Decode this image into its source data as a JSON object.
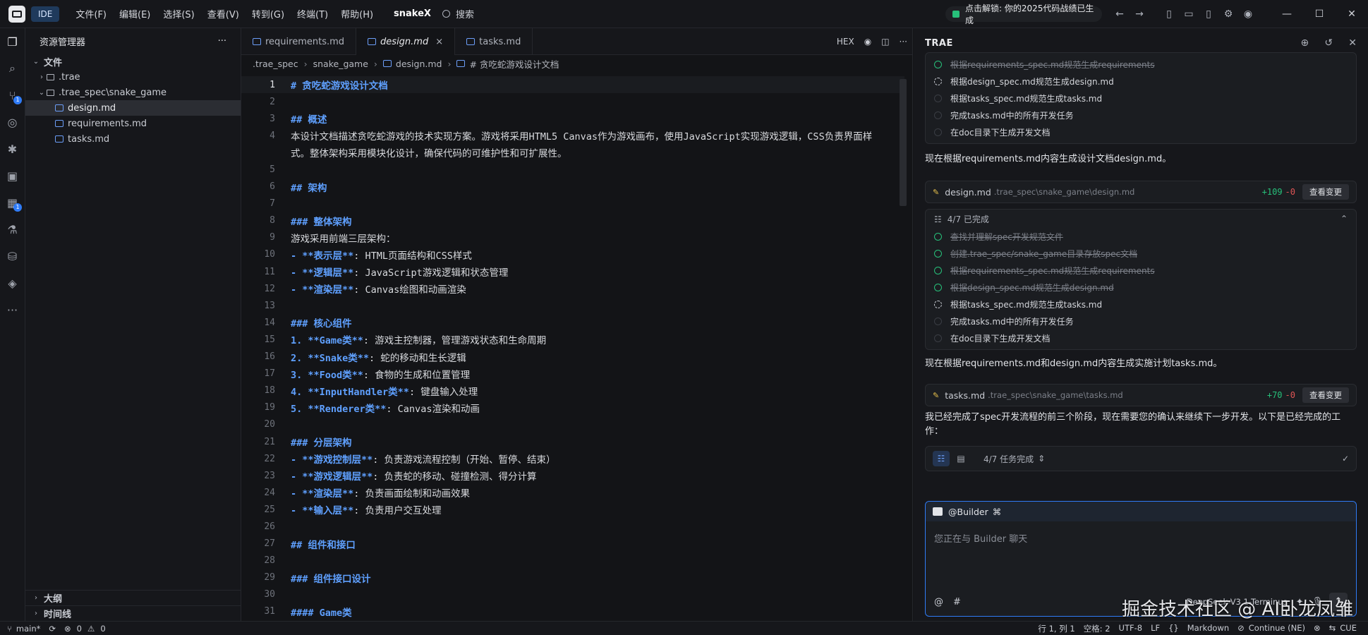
{
  "titlebar": {
    "ide_label": "IDE",
    "menu": [
      "文件(F)",
      "编辑(E)",
      "选择(S)",
      "查看(V)",
      "转到(G)",
      "终端(T)",
      "帮助(H)"
    ],
    "project": "snakeX",
    "search_label": "搜索",
    "promo": "点击解锁: 你的2025代码战绩已生成"
  },
  "explorer": {
    "title": "资源管理器",
    "more": "···",
    "root": "文件",
    "items": [
      {
        "label": ".trae",
        "type": "folder"
      },
      {
        "label": ".trae_spec\\snake_game",
        "type": "folder-open"
      },
      {
        "label": "design.md",
        "type": "file"
      },
      {
        "label": "requirements.md",
        "type": "file"
      },
      {
        "label": "tasks.md",
        "type": "file"
      }
    ],
    "outline": "大纲",
    "timeline": "时间线"
  },
  "editor": {
    "tabs": [
      {
        "label": "requirements.md"
      },
      {
        "label": "design.md",
        "close": "×"
      },
      {
        "label": "tasks.md"
      }
    ],
    "tools": {
      "hex": "HEX"
    },
    "breadcrumb": [
      ".trae_spec",
      "snake_game",
      "design.md",
      "# 贪吃蛇游戏设计文档"
    ],
    "lines": [
      {
        "n": "1",
        "t": "# 贪吃蛇游戏设计文档",
        "k": "h"
      },
      {
        "n": "2",
        "t": "",
        "k": ""
      },
      {
        "n": "3",
        "t": "## 概述",
        "k": "h"
      },
      {
        "n": "4",
        "t": "本设计文档描述贪吃蛇游戏的技术实现方案。游戏将采用HTML5 Canvas作为游戏画布，使用JavaScript实现游戏逻辑，CSS负责界面样",
        "k": ""
      },
      {
        "n": "",
        "t": "式。整体架构采用模块化设计，确保代码的可维护性和可扩展性。",
        "k": ""
      },
      {
        "n": "5",
        "t": "",
        "k": ""
      },
      {
        "n": "6",
        "t": "## 架构",
        "k": "h"
      },
      {
        "n": "7",
        "t": "",
        "k": ""
      },
      {
        "n": "8",
        "t": "### 整体架构",
        "k": "h"
      },
      {
        "n": "9",
        "t": "游戏采用前端三层架构：",
        "k": ""
      },
      {
        "n": "10",
        "m": "- **表示层**",
        "t": ": HTML页面结构和CSS样式",
        "k": "l"
      },
      {
        "n": "11",
        "m": "- **逻辑层**",
        "t": ": JavaScript游戏逻辑和状态管理",
        "k": "l"
      },
      {
        "n": "12",
        "m": "- **渲染层**",
        "t": ": Canvas绘图和动画渲染",
        "k": "l"
      },
      {
        "n": "13",
        "t": "",
        "k": ""
      },
      {
        "n": "14",
        "t": "### 核心组件",
        "k": "h"
      },
      {
        "n": "15",
        "m": "1. **Game类**",
        "t": ": 游戏主控制器，管理游戏状态和生命周期",
        "k": "l"
      },
      {
        "n": "16",
        "m": "2. **Snake类**",
        "t": ": 蛇的移动和生长逻辑",
        "k": "l"
      },
      {
        "n": "17",
        "m": "3. **Food类**",
        "t": ": 食物的生成和位置管理",
        "k": "l"
      },
      {
        "n": "18",
        "m": "4. **InputHandler类**",
        "t": ": 键盘输入处理",
        "k": "l"
      },
      {
        "n": "19",
        "m": "5. **Renderer类**",
        "t": ": Canvas渲染和动画",
        "k": "l"
      },
      {
        "n": "20",
        "t": "",
        "k": ""
      },
      {
        "n": "21",
        "t": "### 分层架构",
        "k": "h"
      },
      {
        "n": "22",
        "m": "- **游戏控制层**",
        "t": ": 负责游戏流程控制（开始、暂停、结束）",
        "k": "l"
      },
      {
        "n": "23",
        "m": "- **游戏逻辑层**",
        "t": ": 负责蛇的移动、碰撞检测、得分计算",
        "k": "l"
      },
      {
        "n": "24",
        "m": "- **渲染层**",
        "t": ": 负责画面绘制和动画效果",
        "k": "l"
      },
      {
        "n": "25",
        "m": "- **输入层**",
        "t": ": 负责用户交互处理",
        "k": "l"
      },
      {
        "n": "26",
        "t": "",
        "k": ""
      },
      {
        "n": "27",
        "t": "## 组件和接口",
        "k": "h"
      },
      {
        "n": "28",
        "t": "",
        "k": ""
      },
      {
        "n": "29",
        "t": "### 组件接口设计",
        "k": "h"
      },
      {
        "n": "30",
        "t": "",
        "k": ""
      },
      {
        "n": "31",
        "t": "#### Game类",
        "k": "h"
      }
    ]
  },
  "chat": {
    "title": "TRAE",
    "todo_top": [
      {
        "label": "根据requirements_spec.md规范生成requirements",
        "state": "done"
      },
      {
        "label": "根据design_spec.md规范生成design.md",
        "state": "spin"
      },
      {
        "label": "根据tasks_spec.md规范生成tasks.md",
        "state": "open"
      },
      {
        "label": "完成tasks.md中的所有开发任务",
        "state": "open"
      },
      {
        "label": "在doc目录下生成开发文档",
        "state": "open"
      }
    ],
    "msg1": "现在根据requirements.md内容生成设计文档design.md。",
    "file1": {
      "name": "design.md",
      "path": ".trae_spec\\snake_game\\design.md",
      "add": "+109",
      "del": "-0",
      "btn": "查看变更"
    },
    "progress_label": "4/7 已完成",
    "todo_mid": [
      {
        "label": "查找并理解spec开发规范文件",
        "state": "done"
      },
      {
        "label": "创建.trae_spec/snake_game目录存放spec文档",
        "state": "done"
      },
      {
        "label": "根据requirements_spec.md规范生成requirements",
        "state": "done"
      },
      {
        "label": "根据design_spec.md规范生成design.md",
        "state": "done"
      },
      {
        "label": "根据tasks_spec.md规范生成tasks.md",
        "state": "spin"
      },
      {
        "label": "完成tasks.md中的所有开发任务",
        "state": "open"
      },
      {
        "label": "在doc目录下生成开发文档",
        "state": "open"
      }
    ],
    "msg2": "现在根据requirements.md和design.md内容生成实施计划tasks.md。",
    "file2": {
      "name": "tasks.md",
      "path": ".trae_spec\\snake_game\\tasks.md",
      "add": "+70",
      "del": "-0",
      "btn": "查看变更"
    },
    "msg3": "我已经完成了spec开发流程的前三个阶段，现在需要您的确认来继续下一步开发。以下是已经完成的工作：",
    "task_bar": "4/7 任务完成",
    "builder": "@Builder",
    "placeholder": "您正在与 Builder 聊天",
    "model": "DeepSeek-V3.1-Terminus",
    "watermark": "掘金技术社区 @ AI卧龙凤雏"
  },
  "statusbar": {
    "branch": "main*",
    "errors": "0",
    "warnings": "0",
    "position": "行 1, 列 1",
    "spaces": "空格: 2",
    "encoding": "UTF-8",
    "eol": "LF",
    "braces": "{}",
    "lang": "Markdown",
    "continue": "Continue (NE)",
    "cue": "CUE"
  }
}
